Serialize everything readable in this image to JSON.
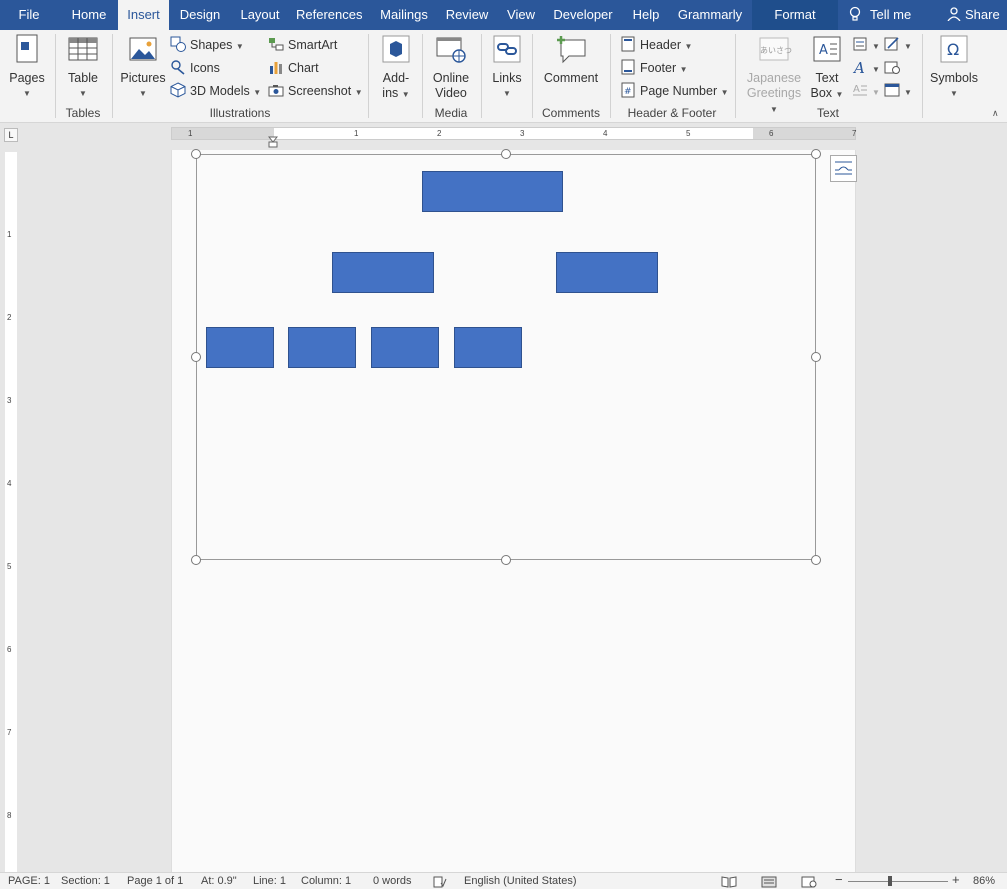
{
  "tabs": [
    {
      "label": "File"
    },
    {
      "label": "Home"
    },
    {
      "label": "Insert"
    },
    {
      "label": "Design"
    },
    {
      "label": "Layout"
    },
    {
      "label": "References"
    },
    {
      "label": "Mailings"
    },
    {
      "label": "Review"
    },
    {
      "label": "View"
    },
    {
      "label": "Developer"
    },
    {
      "label": "Help"
    },
    {
      "label": "Grammarly"
    },
    {
      "label": "Format"
    }
  ],
  "tellme": "Tell me",
  "share": "Share",
  "ribbon": {
    "pages": "Pages",
    "tables": {
      "table": "Table",
      "label": "Tables"
    },
    "illustrations": {
      "pictures": "Pictures",
      "shapes": "Shapes",
      "icons": "Icons",
      "models": "3D Models",
      "smartart": "SmartArt",
      "chart": "Chart",
      "screenshot": "Screenshot",
      "label": "Illustrations"
    },
    "addins": {
      "line1": "Add-",
      "line2": "ins"
    },
    "media": {
      "line1": "Online",
      "line2": "Video",
      "label": "Media"
    },
    "links": "Links",
    "comments": {
      "comment": "Comment",
      "label": "Comments"
    },
    "headerfooter": {
      "header": "Header",
      "footer": "Footer",
      "pagenumber": "Page Number",
      "label": "Header & Footer"
    },
    "text": {
      "jp1": "Japanese",
      "jp2": "Greetings",
      "tb1": "Text",
      "tb2": "Box",
      "label": "Text",
      "jp_icon": "あいさつ"
    },
    "symbols": "Symbols",
    "ruler_corner": "L"
  },
  "ruler_h_numbers": [
    "1",
    "1",
    "2",
    "3",
    "4",
    "5",
    "6",
    "7"
  ],
  "ruler_v_numbers": [
    "1",
    "2",
    "3",
    "4",
    "5",
    "6",
    "7",
    "8"
  ],
  "status": {
    "page": "PAGE: 1",
    "section": "Section: 1",
    "pageof": "Page 1 of 1",
    "at": "At: 0.9\"",
    "line": "Line: 1",
    "column": "Column: 1",
    "words": "0 words",
    "language": "English (United States)",
    "zoom": "86%"
  },
  "colors": {
    "accent": "#2b579a",
    "shape_fill": "#4472c4",
    "shape_border": "#2f528f"
  }
}
